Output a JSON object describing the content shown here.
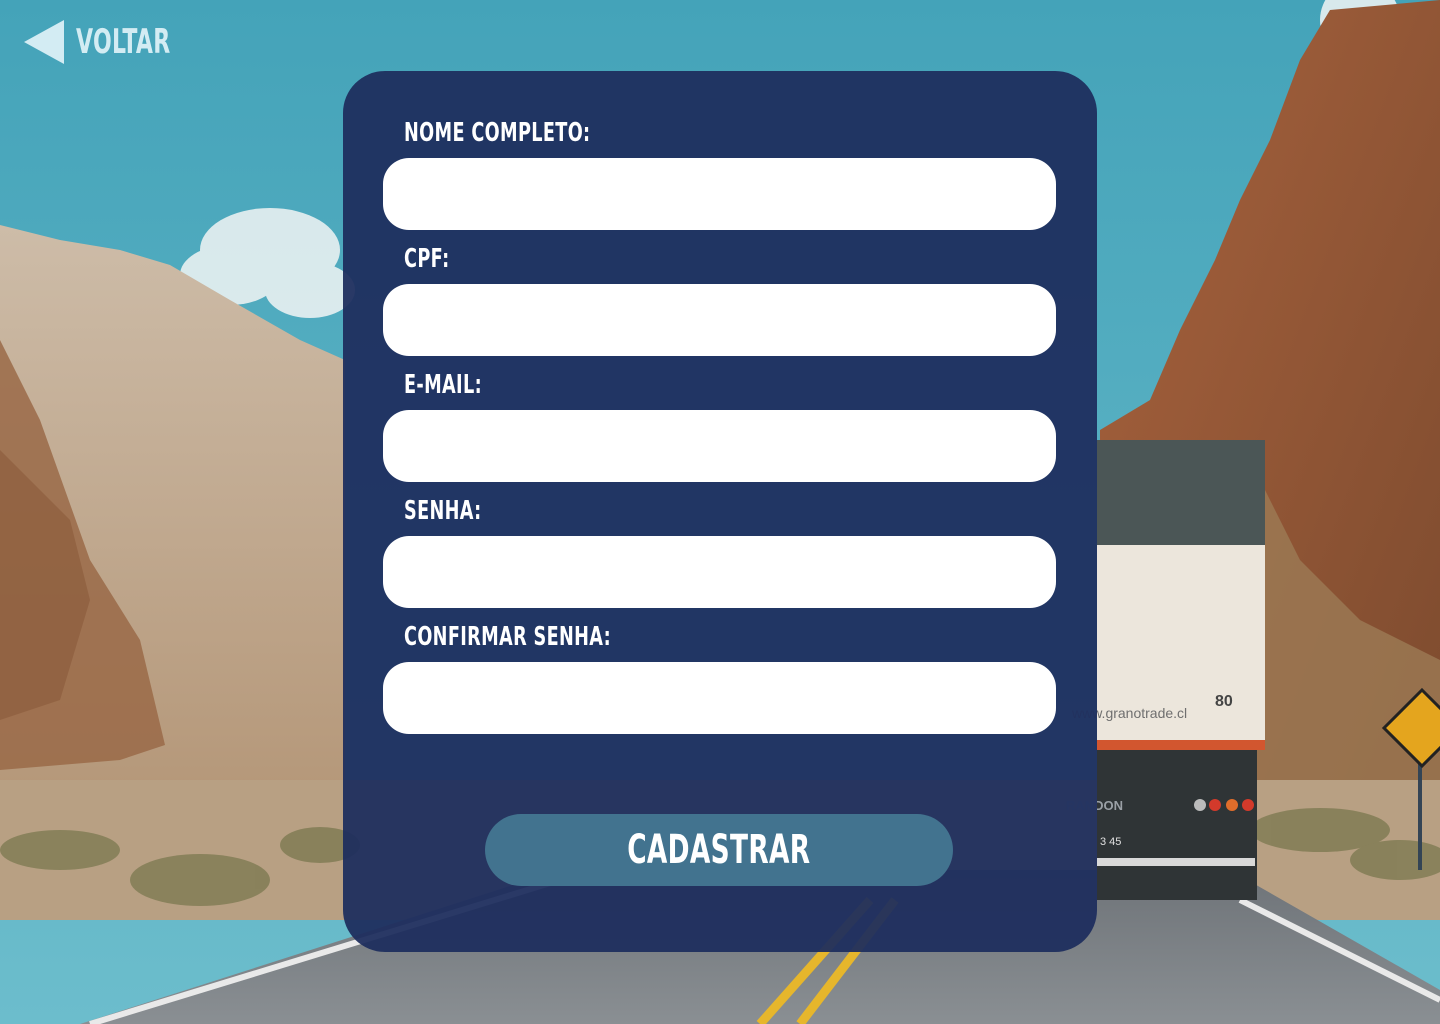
{
  "navigation": {
    "back_label": "VOLTAR"
  },
  "form": {
    "fields": [
      {
        "label": "NOME COMPLETO:",
        "value": ""
      },
      {
        "label": "CPF:",
        "value": ""
      },
      {
        "label": "E-MAIL:",
        "value": ""
      },
      {
        "label": "SENHA:",
        "value": ""
      },
      {
        "label": "CONFIRMAR SENHA:",
        "value": ""
      }
    ],
    "submit_label": "CADASTRAR"
  },
  "background": {
    "truck_sign_text": "www.granotrade.cl",
    "truck_number": "80",
    "trailer_brand": "RANDON",
    "plate_text": "3 45"
  },
  "colors": {
    "card": "#1e2e5e",
    "button": "#42738f",
    "back": "#d3ecf3",
    "sky": "#4aa6bb"
  }
}
